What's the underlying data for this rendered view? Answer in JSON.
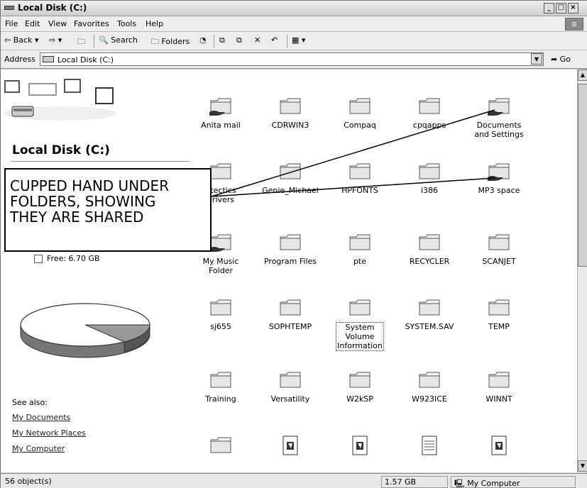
{
  "window": {
    "title": "Local Disk (C:)"
  },
  "menu": [
    "File",
    "Edit",
    "View",
    "Favorites",
    "Tools",
    "Help"
  ],
  "toolbar": {
    "back_label": "Back",
    "search_label": "Search",
    "folders_label": "Folders"
  },
  "address": {
    "label": "Address",
    "value": "Local Disk (C:)",
    "go_label": "Go"
  },
  "left_panel": {
    "title": "Local Disk (C:)",
    "free_label": "Free: 6.70 GB",
    "see_also_label": "See also:",
    "links": [
      "My Documents",
      "My Network Places",
      "My Computer"
    ]
  },
  "annotation": {
    "lines": [
      "CUPPED HAND UNDER",
      "FOLDERS, SHOWING",
      "THEY ARE SHARED"
    ]
  },
  "items": [
    {
      "label": "Anita mail",
      "type": "shared-folder"
    },
    {
      "label": "CDRWIN3",
      "type": "folder"
    },
    {
      "label": "Compaq",
      "type": "folder"
    },
    {
      "label": "cpqapps",
      "type": "folder"
    },
    {
      "label": "Documents\nand Settings",
      "type": "shared-folder"
    },
    {
      "label": "utectics\ndrivers",
      "type": "folder"
    },
    {
      "label": "Genie_Michael",
      "type": "folder"
    },
    {
      "label": "HPFONTS",
      "type": "folder"
    },
    {
      "label": "i386",
      "type": "folder"
    },
    {
      "label": "MP3 space",
      "type": "shared-folder"
    },
    {
      "label": "My Music\nFolder",
      "type": "shared-folder"
    },
    {
      "label": "Program Files",
      "type": "folder"
    },
    {
      "label": "pte",
      "type": "folder"
    },
    {
      "label": "RECYCLER",
      "type": "folder"
    },
    {
      "label": "SCANJET",
      "type": "folder"
    },
    {
      "label": "sj655",
      "type": "folder"
    },
    {
      "label": "SOPHTEMP",
      "type": "folder"
    },
    {
      "label": "System\nVolume\nInformation",
      "type": "folder",
      "selected": true
    },
    {
      "label": "SYSTEM.SAV",
      "type": "folder"
    },
    {
      "label": "TEMP",
      "type": "folder"
    },
    {
      "label": "Training",
      "type": "folder"
    },
    {
      "label": "Versatility",
      "type": "folder"
    },
    {
      "label": "W2kSP",
      "type": "folder"
    },
    {
      "label": "W923ICE",
      "type": "folder"
    },
    {
      "label": "WINNT",
      "type": "folder"
    },
    {
      "label": "",
      "type": "folder"
    },
    {
      "label": "",
      "type": "system-file"
    },
    {
      "label": "",
      "type": "system-file"
    },
    {
      "label": "",
      "type": "text-file"
    },
    {
      "label": "",
      "type": "system-file"
    }
  ],
  "status": {
    "objects": "56 object(s)",
    "size": "1.57 GB",
    "zone": "My Computer"
  }
}
